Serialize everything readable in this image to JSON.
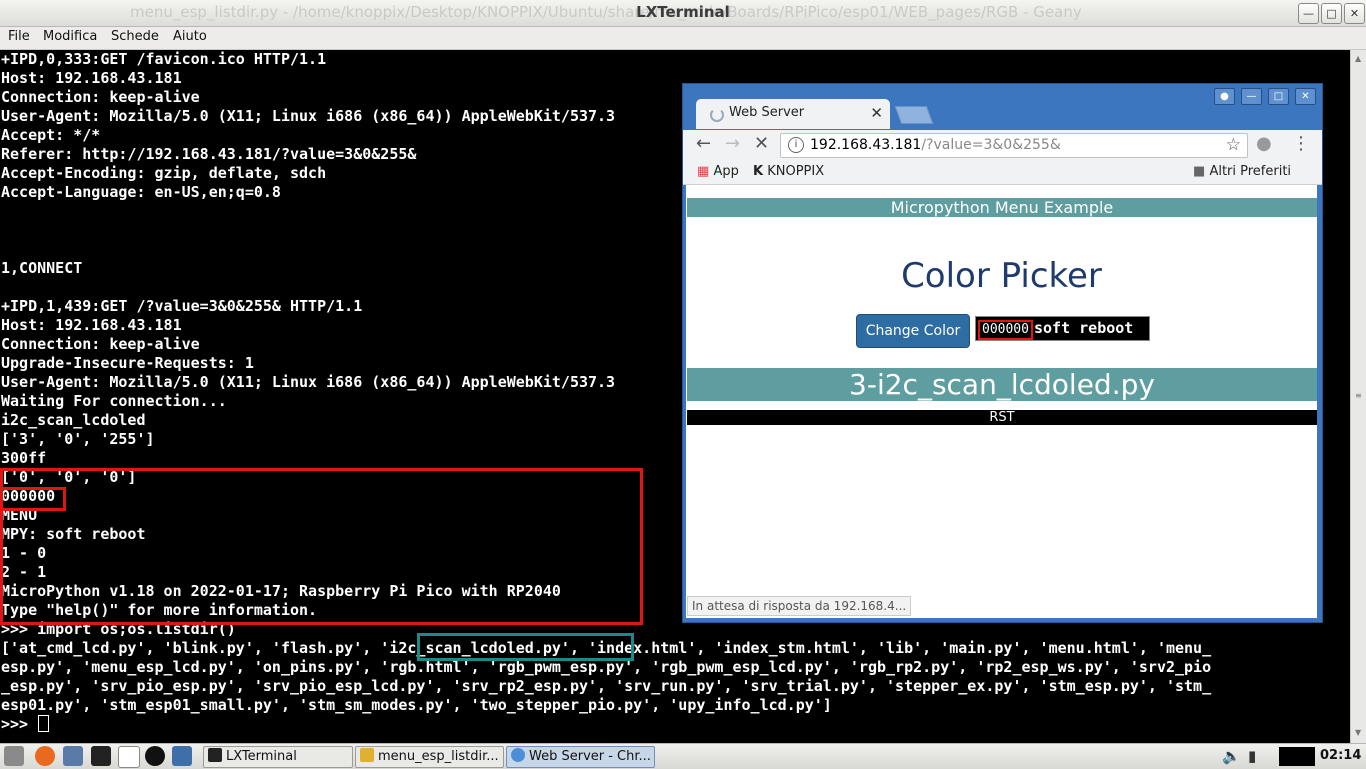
{
  "window": {
    "title": "LXTerminal",
    "background_title": "menu_esp_listdir.py - /home/knoppix/Desktop/KNOPPIX/Ubuntu/share/mu_code/Boards/RPiPico/esp01/WEB_pages/RGB - Geany"
  },
  "menubar": {
    "items": [
      "File",
      "Modifica",
      "Schede",
      "Aiuto"
    ]
  },
  "terminal": {
    "lines_top": [
      "+IPD,0,333:GET /favicon.ico HTTP/1.1",
      "Host: 192.168.43.181",
      "Connection: keep-alive",
      "User-Agent: Mozilla/5.0 (X11; Linux i686 (x86_64)) AppleWebKit/537.3",
      "Accept: */*",
      "Referer: http://192.168.43.181/?value=3&0&255&",
      "Accept-Encoding: gzip, deflate, sdch",
      "Accept-Language: en-US,en;q=0.8",
      "",
      "",
      "",
      "1,CONNECT",
      "",
      "+IPD,1,439:GET /?value=3&0&255& HTTP/1.1",
      "Host: 192.168.43.181",
      "Connection: keep-alive",
      "Upgrade-Insecure-Requests: 1",
      "User-Agent: Mozilla/5.0 (X11; Linux i686 (x86_64)) AppleWebKit/537.3",
      "Waiting For connection...",
      "i2c_scan_lcdoled",
      "['3', '0', '255']",
      "300ff",
      "['0', '0', '0']",
      "000000",
      "MENU",
      "MPY: soft reboot",
      "1 - 0",
      "2 - 1",
      "MicroPython v1.18 on 2022-01-17; Raspberry Pi Pico with RP2040",
      "Type \"help()\" for more information.",
      ">>> import os;os.listdir()"
    ],
    "listdir_lines": [
      "['at_cmd_lcd.py', 'blink.py', 'flash.py', 'i2c_scan_lcdoled.py', 'index.html', 'index_stm.html', 'lib', 'main.py', 'menu.html', 'menu_",
      "esp.py', 'menu_esp_lcd.py', 'on_pins.py', 'rgb.html', 'rgb_pwm_esp.py', 'rgb_pwm_esp_lcd.py', 'rgb_rp2.py', 'rp2_esp_ws.py', 'srv2_pio",
      "_esp.py', 'srv_pio_esp.py', 'srv_pio_esp_lcd.py', 'srv_rp2_esp.py', 'srv_run.py', 'srv_trial.py', 'stepper_ex.py', 'stm_esp.py', 'stm_",
      "esp01.py', 'stm_esp01_small.py', 'stm_sm_modes.py', 'two_stepper_pio.py', 'upy_info_lcd.py']"
    ],
    "prompt": ">>> "
  },
  "browser": {
    "tab_title": "Web Server",
    "url_host": "192.168.43.181",
    "url_rest": "/?value=3&0&255&",
    "bookmarks": {
      "apps": "App",
      "knoppix": "KNOPPIX",
      "others": "Altri Preferiti"
    },
    "page": {
      "menu_header": "Micropython Menu Example",
      "title": "Color Picker",
      "button": "Change Color",
      "mini_console_hex": "000000",
      "mini_console_msg": "soft reboot",
      "file_bar": "3-i2c_scan_lcdoled.py",
      "rst": "RST"
    },
    "status": "In attesa di risposta da 192.168.4..."
  },
  "taskbar": {
    "tasks": [
      "LXTerminal",
      "menu_esp_listdir...",
      "Web Server - Chr..."
    ],
    "clock": "02:14"
  },
  "colors": {
    "highlight_red": "#e01515",
    "highlight_teal": "#1b8a8a",
    "page_teal": "#5f9ea0",
    "button_blue": "#2e6da4",
    "chrome_frame": "#3c76bf"
  }
}
